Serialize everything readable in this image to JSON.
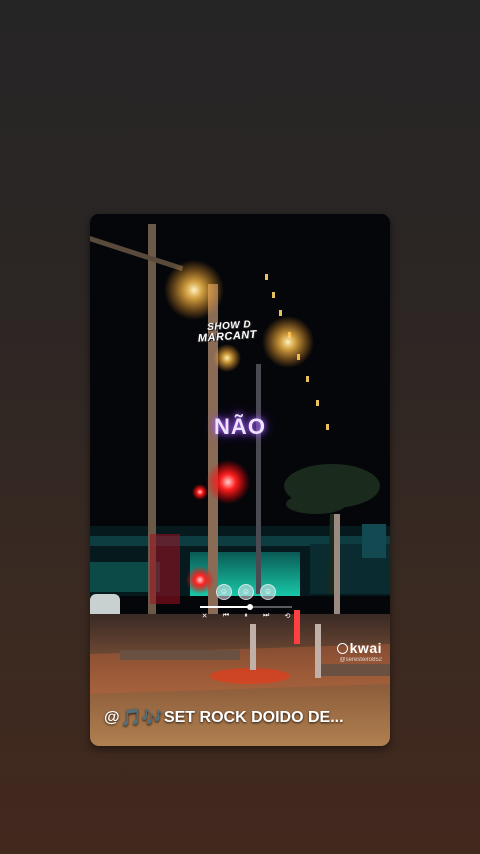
{
  "story": {
    "watermark_line1": "SHOW D",
    "watermark_line2": "MARCANT",
    "lyric_text": "NÃO",
    "caption": {
      "at": "@",
      "notes_icon": "musical-notes-icon",
      "notes_glyph": "🎵🎶",
      "text": "SET ROCK DOIDO DE..."
    },
    "kwai": {
      "brand": "kwai",
      "handle": "@seresteiro852"
    },
    "player": {
      "progress": 0.52,
      "icons": [
        "shuffle-icon",
        "prev-icon",
        "pause-icon",
        "next-icon",
        "repeat-icon"
      ]
    }
  },
  "colors": {
    "lyric_glow": "#b36bff",
    "caption_notes": "#a855f7",
    "teal_light": "#19d3b0",
    "red_light": "#ff2a2a",
    "street_light": "#ffcc66"
  }
}
